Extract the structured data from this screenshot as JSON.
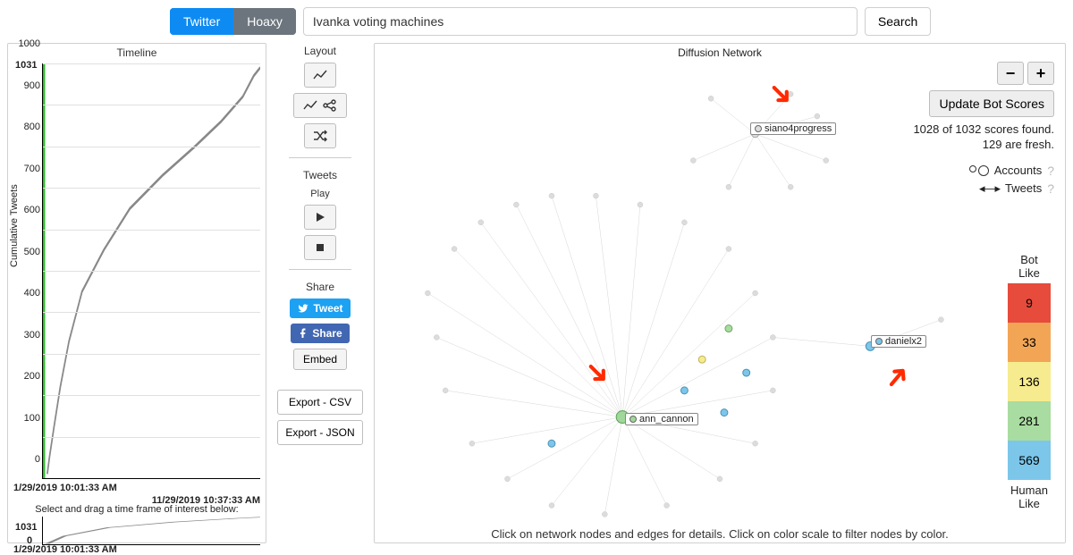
{
  "topbar": {
    "tab_twitter": "Twitter",
    "tab_hoaxy": "Hoaxy",
    "search_value": "Ivanka voting machines",
    "search_button": "Search"
  },
  "timeline": {
    "title": "Timeline",
    "ylabel": "Cumulative Tweets",
    "ymax_label": "1031",
    "yticks": [
      "0",
      "100",
      "200",
      "300",
      "400",
      "500",
      "600",
      "700",
      "800",
      "900",
      "1000"
    ],
    "x_start": "1/29/2019 10:01:33 AM",
    "x_end": "11/29/2019 10:37:33 AM",
    "brush_label": "Select and drag a time frame of interest below:",
    "brush_ymax": "1031",
    "brush_ymin": "0",
    "brush_xstart": "1/29/2019 10:01:33 AM"
  },
  "controls": {
    "layout_head": "Layout",
    "tweets_head": "Tweets",
    "play_head": "Play",
    "share_head": "Share",
    "tweet_btn": "Tweet",
    "share_btn": "Share",
    "embed_btn": "Embed",
    "export_csv": "Export - CSV",
    "export_json": "Export - JSON"
  },
  "network": {
    "title": "Diffusion Network",
    "zoom_out": "−",
    "zoom_in": "+",
    "update_btn": "Update Bot Scores",
    "score_line1": "1028 of 1032 scores found.",
    "score_line2": "129 are fresh.",
    "legend_accounts": "Accounts",
    "legend_tweets": "Tweets",
    "footer": "Click on network nodes and edges for details. Click on color scale to filter nodes by color.",
    "node_labels": {
      "a": "siano4progress",
      "b": "ann_cannon",
      "c": "danielx2"
    }
  },
  "colorbar": {
    "top_label": "Bot\nLike",
    "bottom_label": "Human\nLike",
    "cells": [
      {
        "value": "9",
        "color": "#e64b3c"
      },
      {
        "value": "33",
        "color": "#f3a556"
      },
      {
        "value": "136",
        "color": "#f6eb8e"
      },
      {
        "value": "281",
        "color": "#a9dca0"
      },
      {
        "value": "569",
        "color": "#7cc6ea"
      }
    ]
  },
  "chart_data": {
    "type": "line",
    "title": "Timeline",
    "xlabel": "",
    "ylabel": "Cumulative Tweets",
    "ylim": [
      0,
      1031
    ],
    "x_range": [
      "1/29/2019 10:01:33 AM",
      "11/29/2019 10:37:33 AM"
    ],
    "series": [
      {
        "name": "cumulative_tweets",
        "points_pct": [
          [
            2,
            99
          ],
          [
            3,
            95
          ],
          [
            5,
            88
          ],
          [
            8,
            78
          ],
          [
            12,
            67
          ],
          [
            18,
            55
          ],
          [
            28,
            45
          ],
          [
            40,
            35
          ],
          [
            55,
            27
          ],
          [
            70,
            20
          ],
          [
            82,
            14
          ],
          [
            92,
            8
          ],
          [
            97,
            3
          ],
          [
            100,
            1
          ]
        ]
      }
    ],
    "note": "points_pct are [x%,y%] of plot area estimated from pixels; y inverted (0=top)."
  }
}
